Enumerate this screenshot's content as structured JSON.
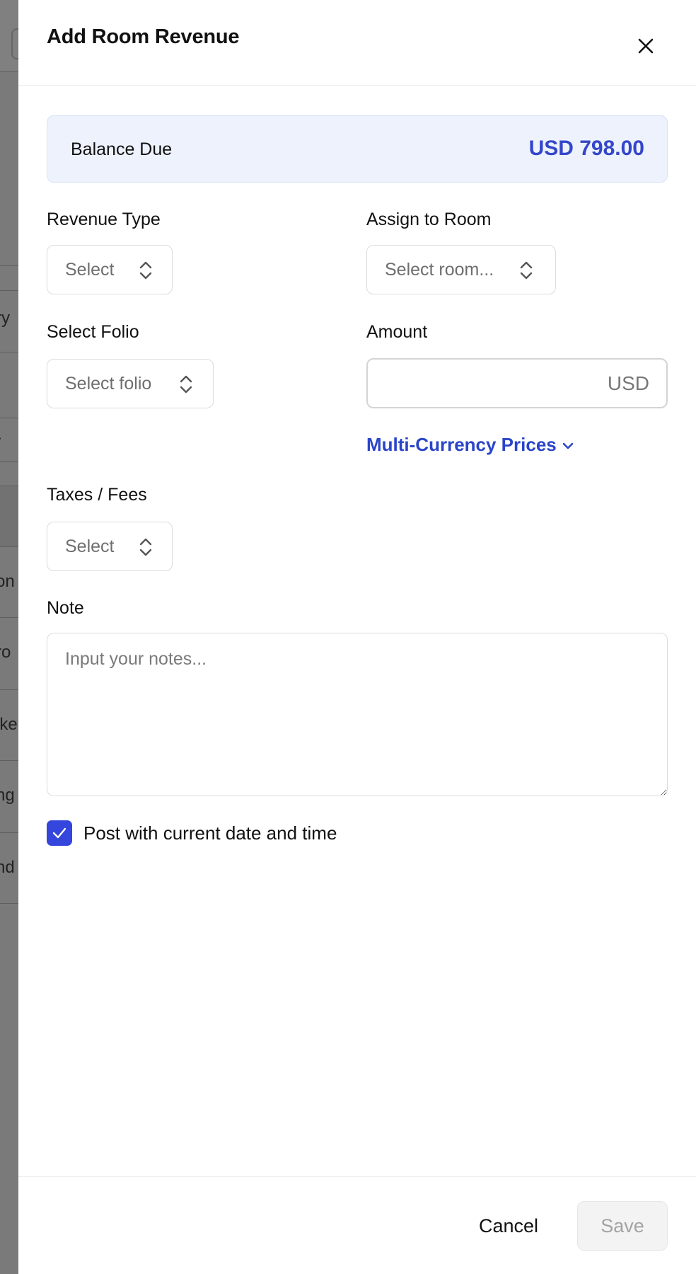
{
  "drawer": {
    "title": "Add Room Revenue"
  },
  "balance": {
    "label": "Balance Due",
    "value": "USD 798.00"
  },
  "fields": {
    "revenue_type": {
      "label": "Revenue Type",
      "value": "Select"
    },
    "assign_room": {
      "label": "Assign to Room",
      "value": "Select room..."
    },
    "folio": {
      "label": "Select Folio",
      "value": "Select folio"
    },
    "amount": {
      "label": "Amount",
      "currency": "USD",
      "value": ""
    },
    "taxes": {
      "label": "Taxes / Fees",
      "value": "Select"
    },
    "note": {
      "label": "Note",
      "placeholder": "Input your notes..."
    }
  },
  "multi_currency": {
    "label": "Multi-Currency Prices"
  },
  "post_now": {
    "label": "Post with current date and time",
    "checked": true
  },
  "footer": {
    "cancel_label": "Cancel",
    "save_label": "Save"
  },
  "backdrop": {
    "fragments": [
      "ry",
      "-",
      "on",
      "ro",
      "ike",
      "ng",
      "nd"
    ]
  },
  "colors": {
    "accent": "#3446c9",
    "link": "#2a44c9",
    "balance_bg": "#edf2fd",
    "checkbox": "#3446dc",
    "overlay": "#7a7a7a"
  }
}
